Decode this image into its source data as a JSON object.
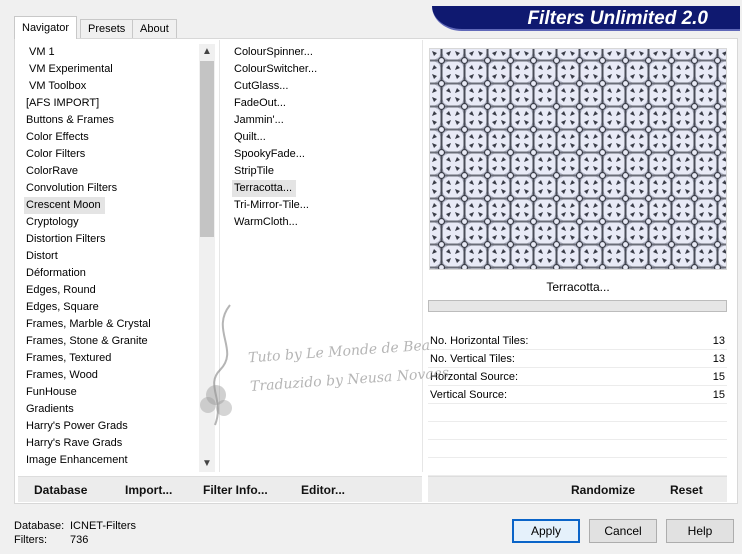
{
  "banner_title": "Filters Unlimited 2.0",
  "tabs": [
    {
      "label": "Navigator",
      "active": true
    },
    {
      "label": "Presets",
      "active": false
    },
    {
      "label": "About",
      "active": false
    }
  ],
  "categories": {
    "items": [
      "VM 1",
      "VM Experimental",
      "VM Toolbox",
      "[AFS IMPORT]",
      "Buttons & Frames",
      "Color Effects",
      "Color Filters",
      "ColorRave",
      "Convolution Filters",
      "Crescent Moon",
      "Cryptology",
      "Distortion Filters",
      "Distort",
      "Déformation",
      "Edges, Round",
      "Edges, Square",
      "Frames, Marble & Crystal",
      "Frames, Stone & Granite",
      "Frames, Textured",
      "Frames, Wood",
      "FunHouse",
      "Gradients",
      "Harry's Power Grads",
      "Harry's Rave Grads",
      "Image Enhancement"
    ],
    "selected": "Crescent Moon"
  },
  "filters": {
    "items": [
      "ColourSpinner...",
      "ColourSwitcher...",
      "CutGlass...",
      "FadeOut...",
      "Jammin'...",
      "Quilt...",
      "SpookyFade...",
      "StripTile",
      "Terracotta...",
      "Tri-Mirror-Tile...",
      "WarmCloth..."
    ],
    "selected": "Terracotta..."
  },
  "toolbar": {
    "database": "Database",
    "import": "Import...",
    "filter_info": "Filter Info...",
    "editor": "Editor..."
  },
  "preview": {
    "filter_name": "Terracotta...",
    "progress": 0
  },
  "params": [
    {
      "label": "No. Horizontal Tiles:",
      "value": "13"
    },
    {
      "label": "No. Vertical Tiles:",
      "value": "13"
    },
    {
      "label": "Horzontal Source:",
      "value": "15"
    },
    {
      "label": "Vertical Source:",
      "value": "15"
    }
  ],
  "actions": {
    "randomize": "Randomize",
    "reset": "Reset"
  },
  "footer": {
    "database_label": "Database:",
    "database_value": "ICNET-Filters",
    "filters_label": "Filters:",
    "filters_value": "736"
  },
  "buttons": {
    "apply": "Apply",
    "cancel": "Cancel",
    "help": "Help"
  },
  "watermark": {
    "line1": "Tuto by Le Monde de Bea",
    "line2": "Traduzido by Neusa Novaes"
  },
  "colors": {
    "banner_bg": "#0f1970",
    "accent": "#0a64c8",
    "preview_bg": "#e8eaf6",
    "pattern_dark": "#3a3d48"
  }
}
